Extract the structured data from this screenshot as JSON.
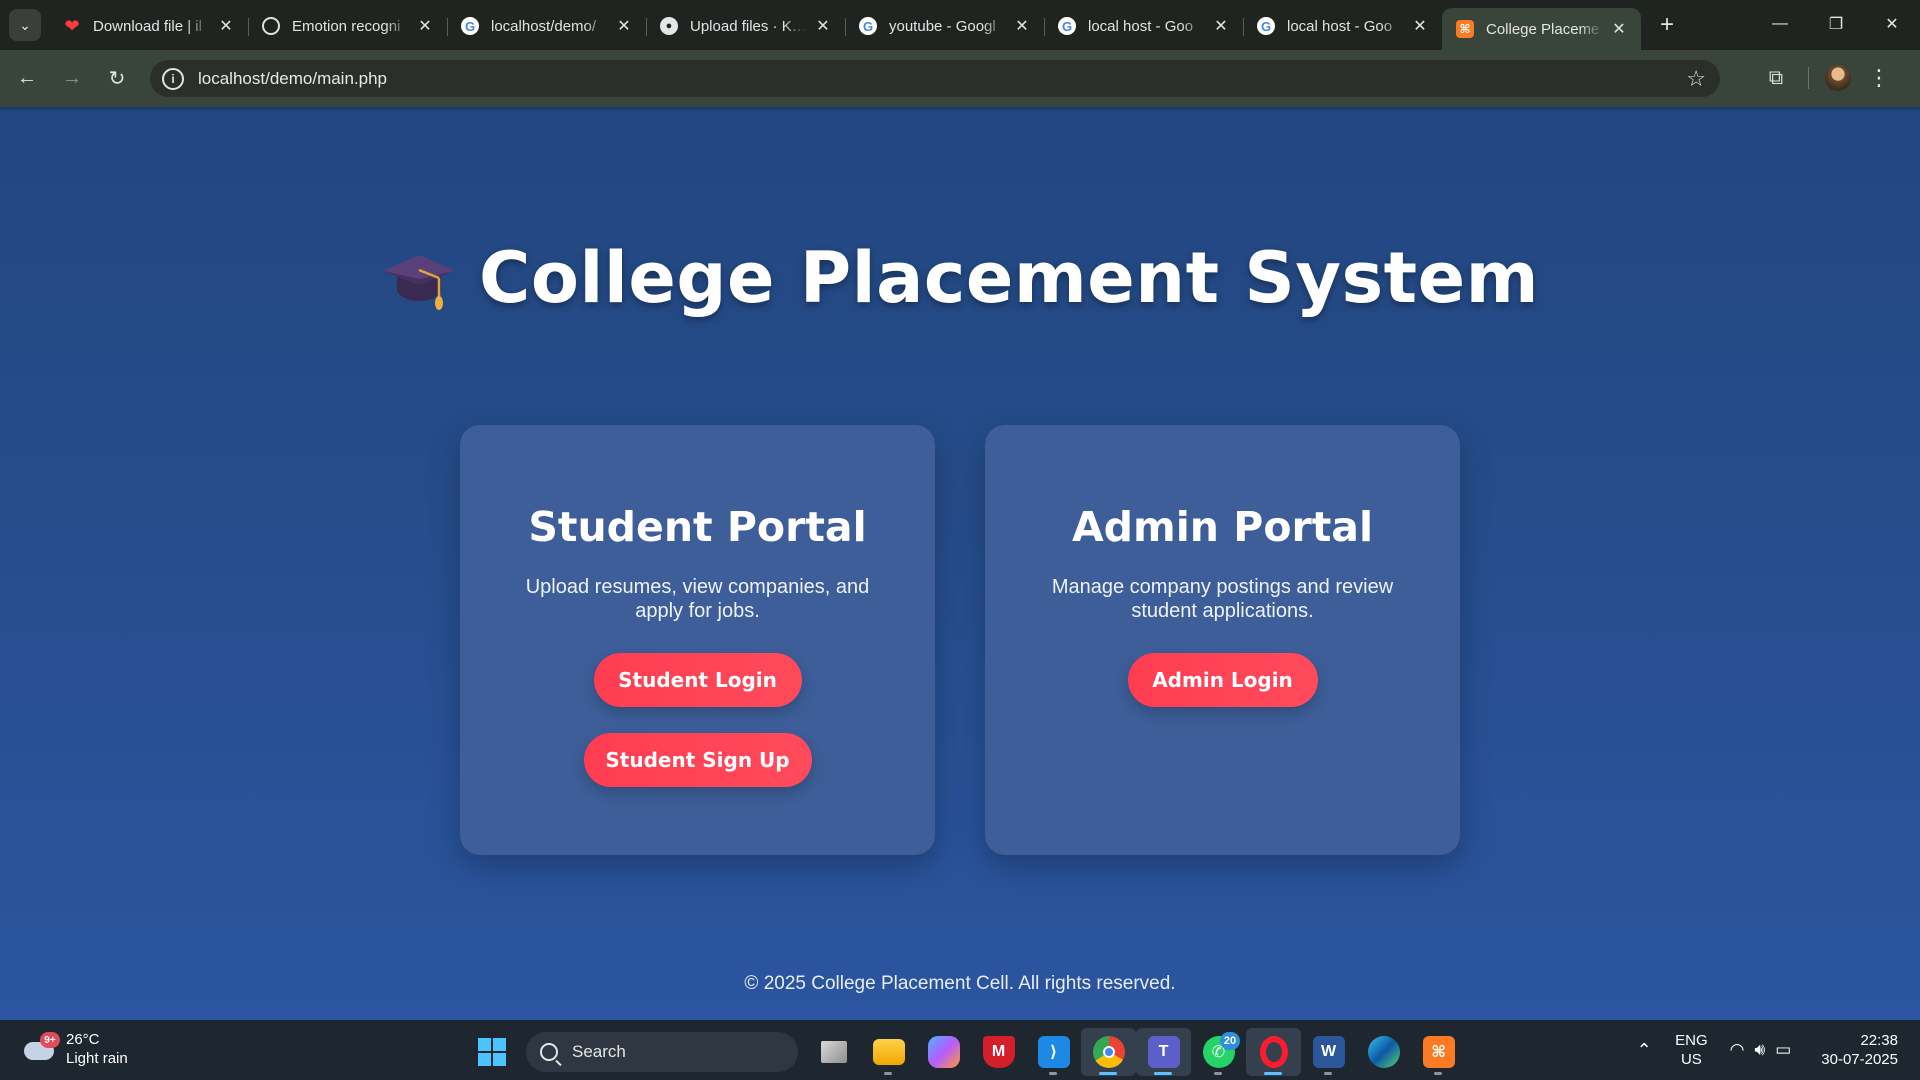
{
  "browser": {
    "tabs": [
      {
        "title": "Download file | il",
        "favicon": "heart-icon"
      },
      {
        "title": "Emotion recogni",
        "favicon": "openai-icon"
      },
      {
        "title": "localhost/demo/",
        "favicon": "google-icon"
      },
      {
        "title": "Upload files · Khu",
        "favicon": "github-icon"
      },
      {
        "title": "youtube - Googl",
        "favicon": "google-icon"
      },
      {
        "title": "local host - Goo",
        "favicon": "google-icon"
      },
      {
        "title": "local host - Goo",
        "favicon": "google-icon"
      },
      {
        "title": "College Placeme",
        "favicon": "xampp-icon",
        "active": true
      }
    ],
    "url": "localhost/demo/main.php"
  },
  "page": {
    "title": "College Placement System",
    "student_card": {
      "heading": "Student Portal",
      "description": "Upload resumes, view companies, and apply for jobs.",
      "login_label": "Student Login",
      "signup_label": "Student Sign Up"
    },
    "admin_card": {
      "heading": "Admin Portal",
      "description": "Manage company postings and review student applications.",
      "login_label": "Admin Login"
    },
    "footer": "© 2025 College Placement Cell. All rights reserved.",
    "colors": {
      "background": "#264d8c",
      "button": "#ff3d52",
      "card": "#3d5e99"
    }
  },
  "taskbar": {
    "weather": {
      "temp": "26°C",
      "condition": "Light rain",
      "badge": "9+"
    },
    "search_label": "Search",
    "whatsapp_badge": "20",
    "lang_top": "ENG",
    "lang_bottom": "US",
    "time": "22:38",
    "date": "30-07-2025"
  }
}
